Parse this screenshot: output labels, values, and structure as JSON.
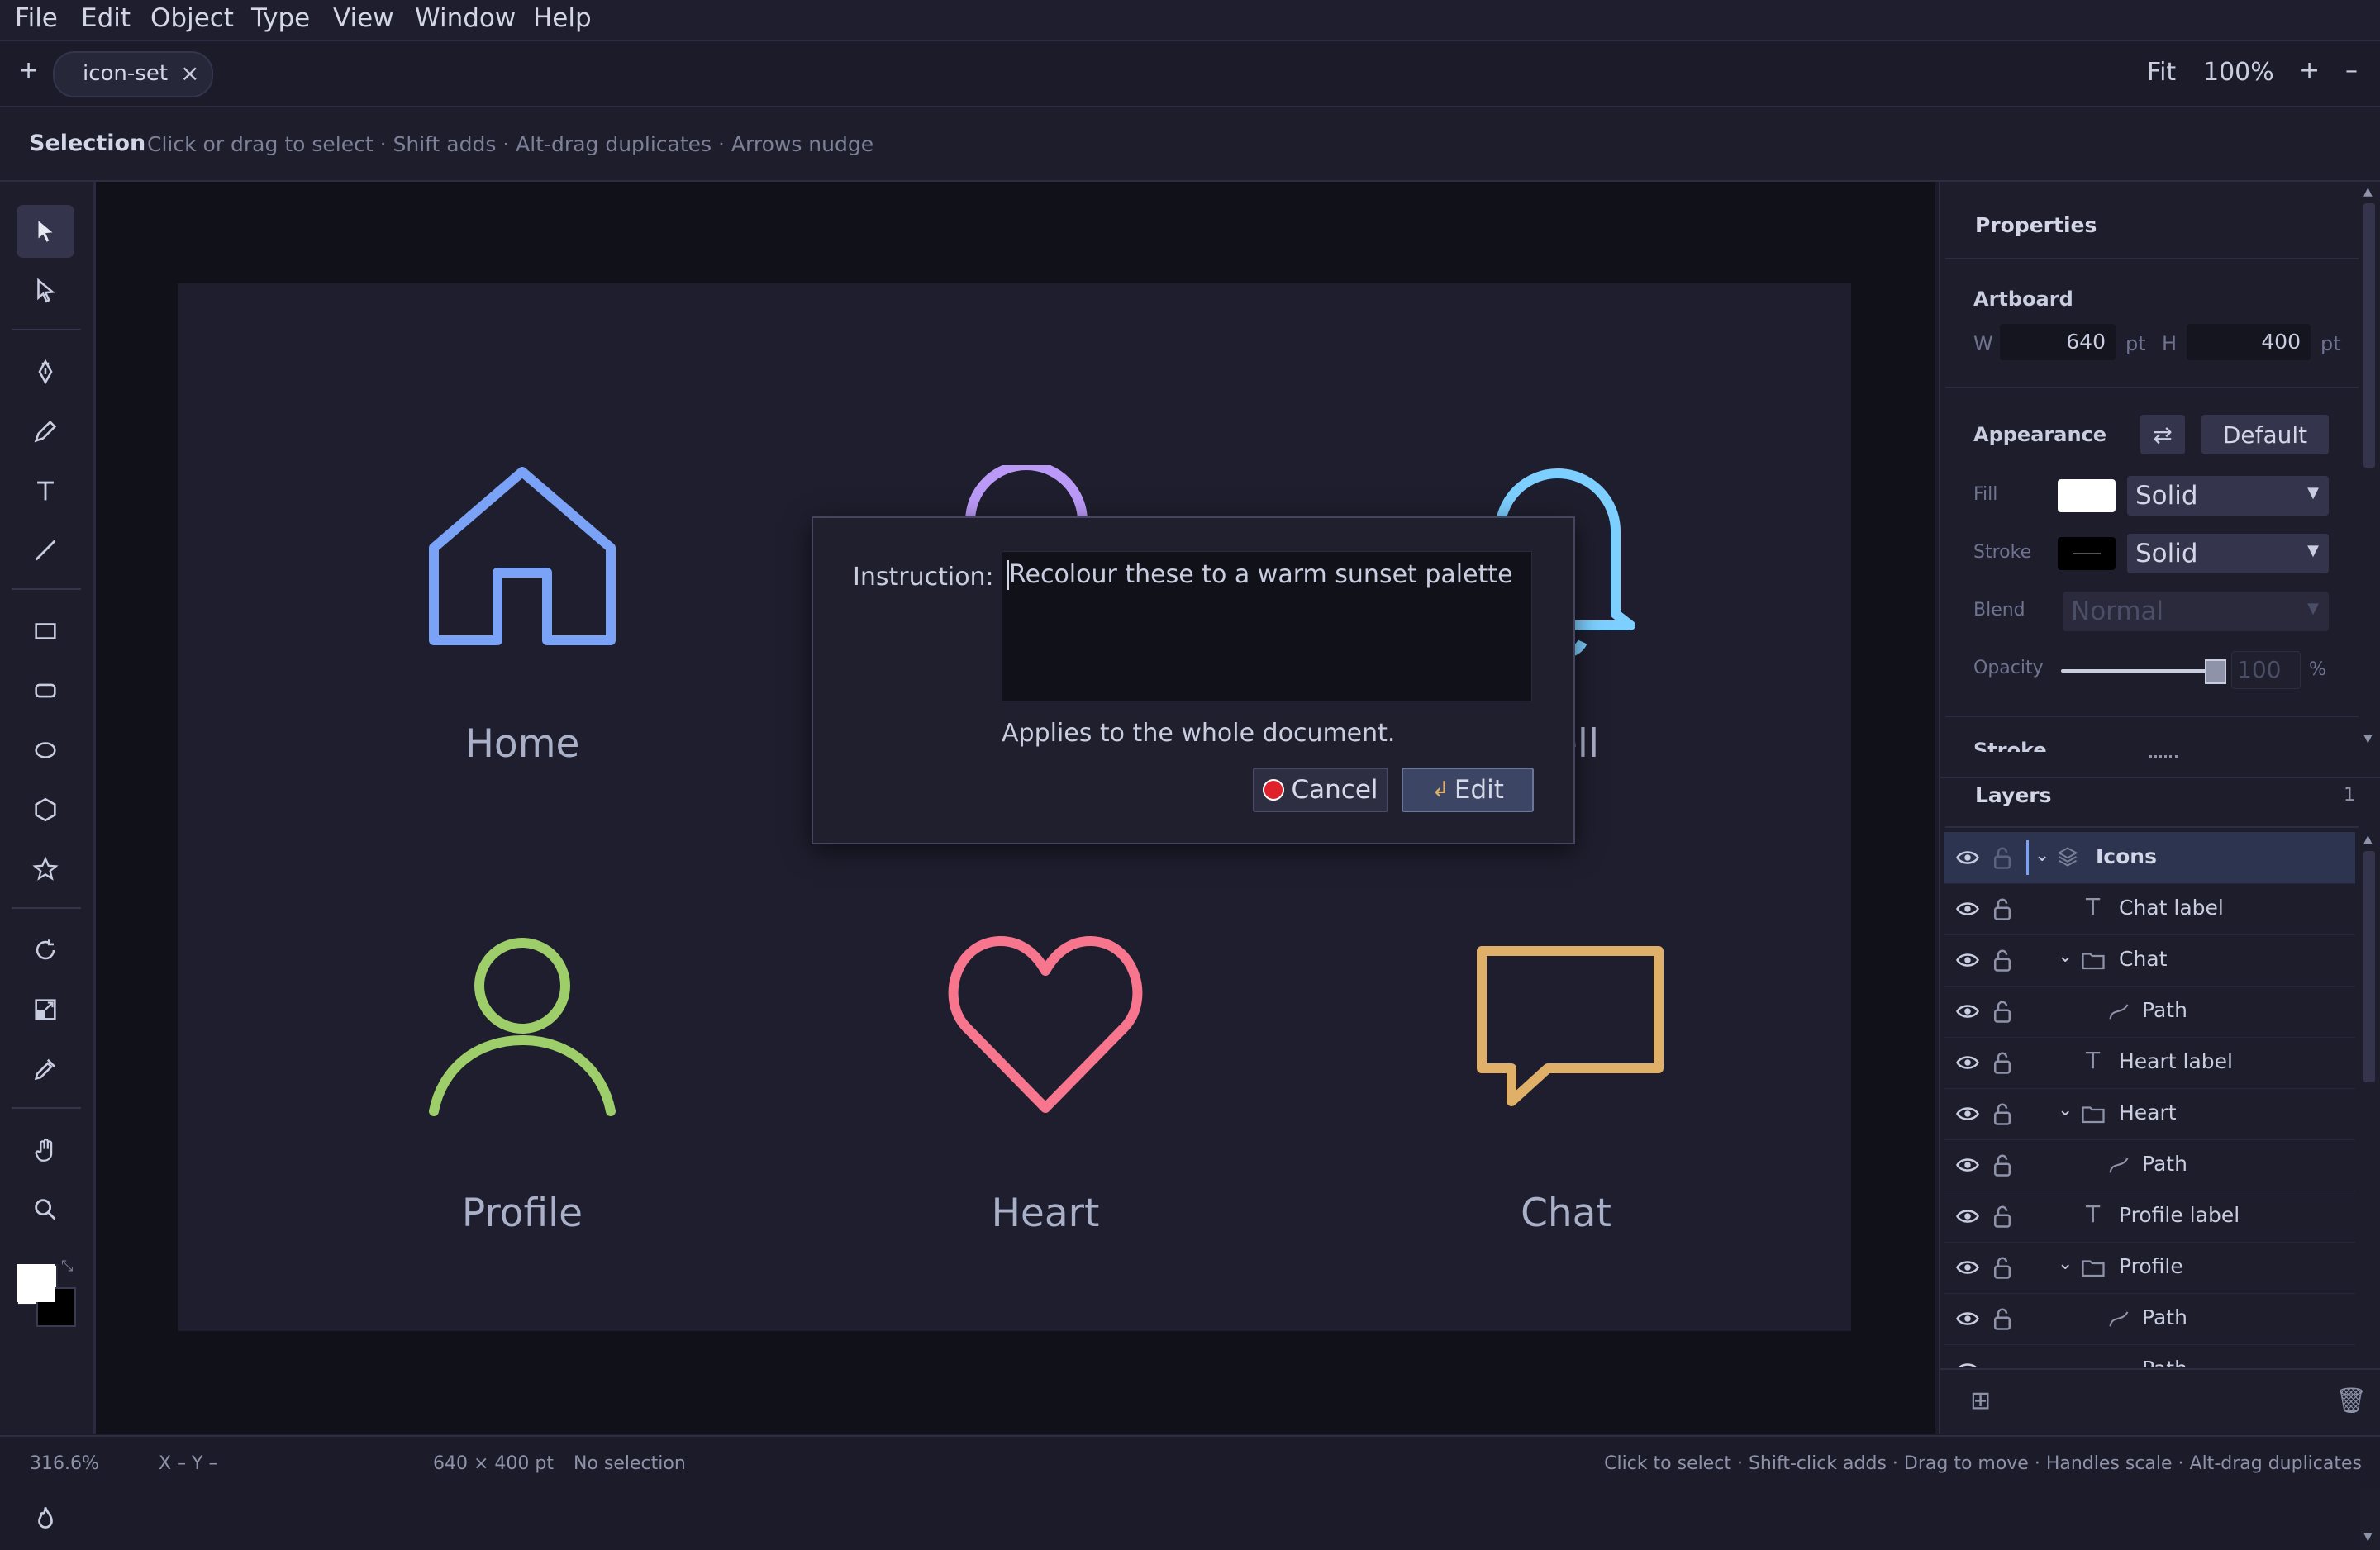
{
  "menubar": {
    "items": [
      "File",
      "Edit",
      "Object",
      "Type",
      "View",
      "Window",
      "Help"
    ]
  },
  "tabbar": {
    "add_label": "+",
    "tab_name": "icon-set",
    "close_label": "×",
    "fit_label": "Fit",
    "zoom_label": "100%",
    "zoom_in_label": "+",
    "zoom_out_label": "–"
  },
  "tool_options": {
    "title": "Selection",
    "hint": "Click or drag to select · Shift adds · Alt-drag duplicates · Arrows nudge"
  },
  "artboard": {
    "icons": [
      {
        "name": "home",
        "label": "Home",
        "color": "#7aa2f7"
      },
      {
        "name": "bell",
        "label": "Bell",
        "color": "#7dcfff"
      },
      {
        "name": "profile",
        "label": "Profile",
        "color": "#9ece6a"
      },
      {
        "name": "heart",
        "label": "Heart",
        "color": "#f7768e"
      },
      {
        "name": "chat",
        "label": "Chat",
        "color": "#e0af68"
      }
    ],
    "bell_label_visible": "ell"
  },
  "dialog": {
    "instruction_label": "Instruction:",
    "instruction_value": "Recolour these to a warm sunset palette",
    "note": "Applies to the whole document.",
    "cancel_label": "Cancel",
    "edit_label": "Edit"
  },
  "properties": {
    "title": "Properties",
    "artboard_title": "Artboard",
    "w_label": "W",
    "w_value": "640",
    "w_unit": "pt",
    "h_label": "H",
    "h_value": "400",
    "h_unit": "pt",
    "appearance_title": "Appearance",
    "default_label": "Default",
    "fill_label": "Fill",
    "fill_type": "Solid",
    "fill_color": "#ffffff",
    "stroke_label": "Stroke",
    "stroke_type": "Solid",
    "blend_label": "Blend",
    "blend_value": "Normal",
    "opacity_label": "Opacity",
    "opacity_value": "100",
    "opacity_unit": "%",
    "stroke_section_title": "Stroke"
  },
  "layers": {
    "title": "Layers",
    "count": "1",
    "rows": [
      {
        "name": "Icons",
        "type": "layer"
      },
      {
        "name": "Chat label",
        "type": "text"
      },
      {
        "name": "Chat",
        "type": "group"
      },
      {
        "name": "Path",
        "type": "path"
      },
      {
        "name": "Heart label",
        "type": "text"
      },
      {
        "name": "Heart",
        "type": "group"
      },
      {
        "name": "Path",
        "type": "path"
      },
      {
        "name": "Profile label",
        "type": "text"
      },
      {
        "name": "Profile",
        "type": "group"
      },
      {
        "name": "Path",
        "type": "path"
      },
      {
        "name": "Path",
        "type": "path"
      }
    ]
  },
  "statusbar": {
    "zoom": "316.6%",
    "coords": "X –  Y –",
    "size": "640 × 400 pt",
    "selection": "No selection",
    "hint": "Click to select · Shift-click adds · Drag to move · Handles scale · Alt-drag duplicates"
  },
  "colors": {
    "accent": "#7aa2f7",
    "selected_row": "#2c3450"
  }
}
